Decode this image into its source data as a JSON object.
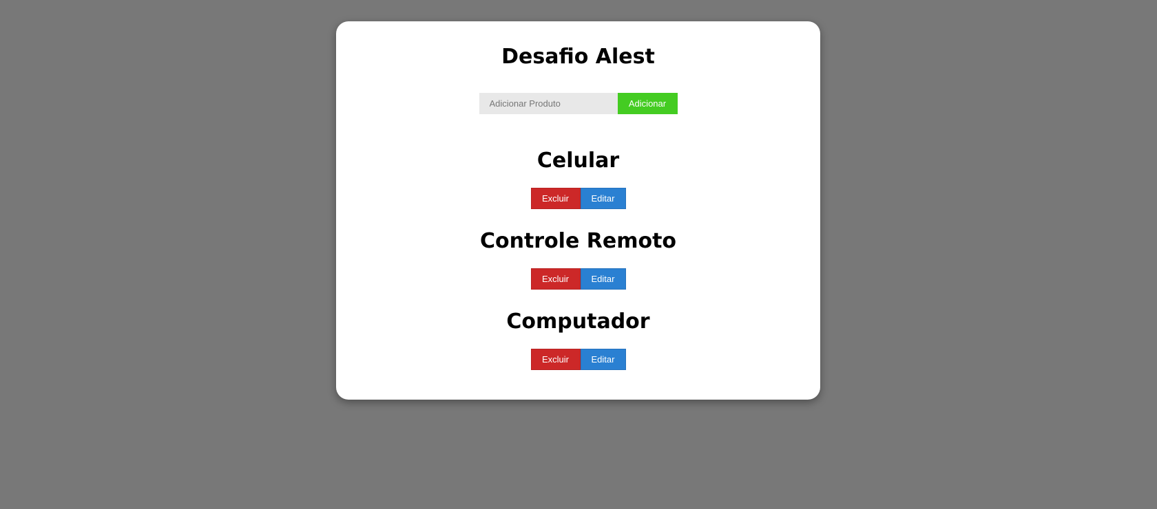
{
  "app": {
    "title": "Desafio Alest"
  },
  "add_form": {
    "placeholder": "Adicionar Produto",
    "value": "",
    "button_label": "Adicionar"
  },
  "products": [
    {
      "name": "Celular",
      "delete_label": "Excluir",
      "edit_label": "Editar"
    },
    {
      "name": "Controle Remoto",
      "delete_label": "Excluir",
      "edit_label": "Editar"
    },
    {
      "name": "Computador",
      "delete_label": "Excluir",
      "edit_label": "Editar"
    }
  ],
  "colors": {
    "page_background": "#787878",
    "card_background": "#ffffff",
    "add_button": "#44cc22",
    "delete_button": "#cc2828",
    "edit_button": "#2a80d2",
    "input_background": "#e8e8e8"
  }
}
